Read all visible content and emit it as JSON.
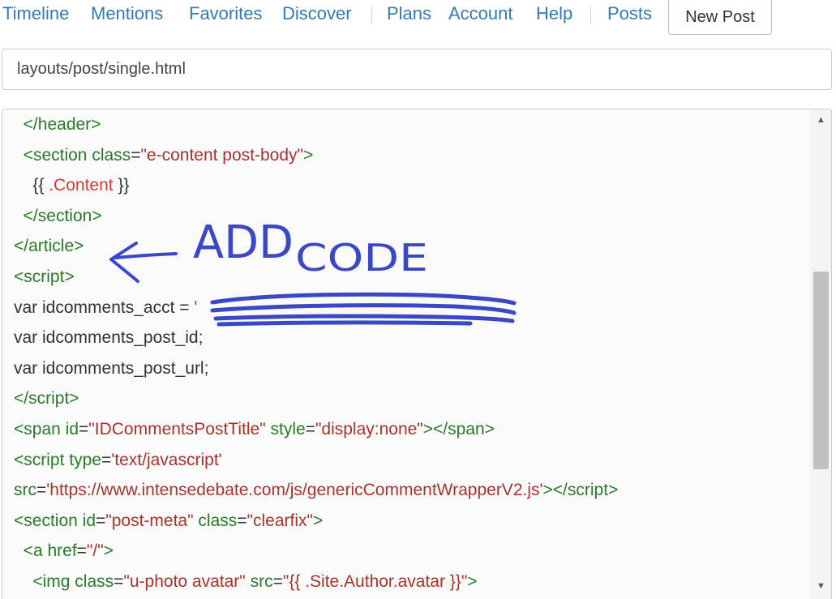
{
  "nav": {
    "timeline": "Timeline",
    "mentions": "Mentions",
    "favorites": "Favorites",
    "discover": "Discover",
    "plans": "Plans",
    "account": "Account",
    "help": "Help",
    "posts": "Posts",
    "new_post": "New Post"
  },
  "path_input": {
    "value": "layouts/post/single.html"
  },
  "code": {
    "lines": [
      [
        "  ",
        "</",
        "header",
        ">"
      ],
      [
        "  ",
        "<",
        "section",
        " ",
        "class",
        "=",
        "\"e-content post-body\"",
        ">"
      ],
      [
        "    ",
        "{{ ",
        ".Content",
        " }}"
      ],
      [
        "  ",
        "</",
        "section",
        ">"
      ],
      [
        "</",
        "article",
        ">"
      ],
      [
        "<",
        "script",
        ">"
      ],
      [
        "var idcomments_acct = ",
        "'"
      ],
      [
        "var idcomments_post_id;"
      ],
      [
        "var idcomments_post_url;"
      ],
      [
        "</",
        "script",
        ">"
      ],
      [
        "<",
        "span",
        " ",
        "id",
        "=",
        "\"IDCommentsPostTitle\"",
        " ",
        "style",
        "=",
        "\"display:none\"",
        "></",
        "span",
        ">"
      ],
      [
        "<",
        "script",
        " ",
        "type",
        "=",
        "'text/javascript'"
      ],
      [
        "src",
        "=",
        "'https://www.intensedebate.com/js/genericCommentWrapperV2.js'",
        "></",
        "script",
        ">"
      ],
      [
        "<",
        "section",
        " ",
        "id",
        "=",
        "\"post-meta\"",
        " ",
        "class",
        "=",
        "\"clearfix\"",
        ">"
      ],
      [
        "  ",
        "<",
        "a",
        " ",
        "href",
        "=",
        "\"/\"",
        ">"
      ],
      [
        "    ",
        "<",
        "img",
        " ",
        "class",
        "=",
        "\"u-photo avatar\"",
        " ",
        "src",
        "=",
        "\"{{ .Site.Author.avatar }}\"",
        ">"
      ]
    ]
  },
  "annotation": {
    "text_line1": "ADD",
    "text_line2": "CODE",
    "color": "#3a47c6"
  },
  "scrollbar": {
    "up_icon": "▲",
    "down_icon": "▼"
  }
}
